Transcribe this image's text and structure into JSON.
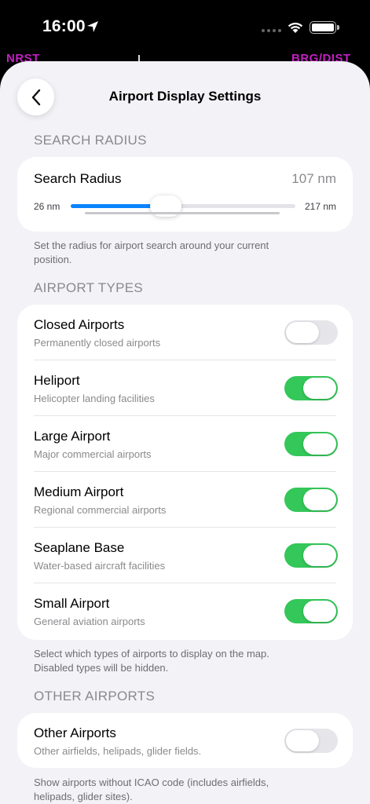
{
  "status": {
    "time": "16:00"
  },
  "background": {
    "left_label": "NRST",
    "right_label": "BRG/DIST"
  },
  "nav": {
    "title": "Airport Display Settings"
  },
  "search_radius": {
    "header": "SEARCH RADIUS",
    "label": "Search Radius",
    "value": "107 nm",
    "min_label": "26 nm",
    "max_label": "217 nm",
    "min": 26,
    "max": 217,
    "current": 107,
    "footer": "Set the radius for airport search around your current position."
  },
  "airport_types": {
    "header": "AIRPORT TYPES",
    "items": [
      {
        "title": "Closed Airports",
        "subtitle": "Permanently closed airports",
        "on": false
      },
      {
        "title": "Heliport",
        "subtitle": "Helicopter landing facilities",
        "on": true
      },
      {
        "title": "Large Airport",
        "subtitle": "Major commercial airports",
        "on": true
      },
      {
        "title": "Medium Airport",
        "subtitle": "Regional commercial airports",
        "on": true
      },
      {
        "title": "Seaplane Base",
        "subtitle": "Water-based aircraft facilities",
        "on": true
      },
      {
        "title": "Small Airport",
        "subtitle": "General aviation airports",
        "on": true
      }
    ],
    "footer": "Select which types of airports to display on the map. Disabled types will be hidden."
  },
  "other_airports": {
    "header": "OTHER AIRPORTS",
    "title": "Other Airports",
    "subtitle": "Other airfields, helipads, glider fields.",
    "on": false,
    "footer": "Show airports without ICAO code (includes airfields, helipads, glider sites)."
  },
  "colors": {
    "accent": "#0a84ff",
    "toggle_on": "#34c759",
    "toggle_off": "#e5e5ea",
    "background_label": "#c41fc4"
  }
}
